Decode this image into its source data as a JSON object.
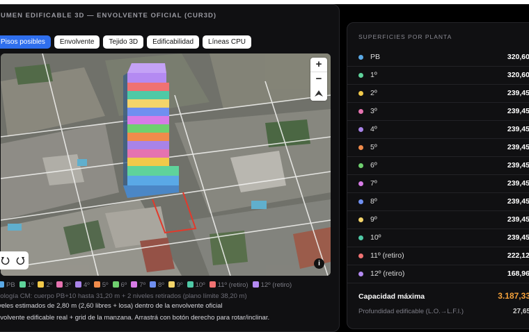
{
  "header": {
    "title": "UMEN EDIFICABLE 3D — ENVOLVENTE OFICIAL (CUR3D)"
  },
  "tabs": [
    {
      "label": "Pisos posibles",
      "active": true
    },
    {
      "label": "Envolvente",
      "active": false
    },
    {
      "label": "Tejido 3D",
      "active": false
    },
    {
      "label": "Edificabilidad",
      "active": false
    },
    {
      "label": "Líneas CPU",
      "active": false
    }
  ],
  "map": {
    "zoom_in": "+",
    "zoom_out": "−",
    "info": "i",
    "rotate_left_icon": "rotate-left-icon",
    "rotate_right_icon": "rotate-right-icon"
  },
  "legend": [
    {
      "label": "PB",
      "color": "#5aa9e6"
    },
    {
      "label": "1º",
      "color": "#5fd39b"
    },
    {
      "label": "2º",
      "color": "#f1c94a"
    },
    {
      "label": "3º",
      "color": "#e573b0"
    },
    {
      "label": "4º",
      "color": "#a883e8"
    },
    {
      "label": "5º",
      "color": "#f08b4b"
    },
    {
      "label": "6º",
      "color": "#6fcf6f"
    },
    {
      "label": "7º",
      "color": "#d77be6"
    },
    {
      "label": "8º",
      "color": "#6f8ff0"
    },
    {
      "label": "9º",
      "color": "#f4d46a"
    },
    {
      "label": "10º",
      "color": "#4fc9a6"
    },
    {
      "label": "11º (retiro)",
      "color": "#f07272"
    },
    {
      "label": "12º (retiro)",
      "color": "#b48af2"
    }
  ],
  "notes": {
    "line1": "pología CM: cuerpo PB+10 hasta 31,20 m + 2 niveles retirados (plano límite 38,20 m)",
    "line2": "iveles estimados de 2,80 m (2,60 libres + losa) dentro de la envolvente oficial",
    "line3": "nvolvente edificable real + grid de la manzana. Arrastrá con botón derecho para rotar/inclinar."
  },
  "surfaces": {
    "title": "SUPERFICIES POR PLANTA",
    "rows": [
      {
        "label": "PB",
        "value": "320,60",
        "color": "#5aa9e6"
      },
      {
        "label": "1º",
        "value": "320,60",
        "color": "#5fd39b"
      },
      {
        "label": "2º",
        "value": "239,45",
        "color": "#f1c94a"
      },
      {
        "label": "3º",
        "value": "239,45",
        "color": "#e573b0"
      },
      {
        "label": "4º",
        "value": "239,45",
        "color": "#a883e8"
      },
      {
        "label": "5º",
        "value": "239,45",
        "color": "#f08b4b"
      },
      {
        "label": "6º",
        "value": "239,45",
        "color": "#6fcf6f"
      },
      {
        "label": "7º",
        "value": "239,45",
        "color": "#d77be6"
      },
      {
        "label": "8º",
        "value": "239,45",
        "color": "#6f8ff0"
      },
      {
        "label": "9º",
        "value": "239,45",
        "color": "#f4d46a"
      },
      {
        "label": "10º",
        "value": "239,45",
        "color": "#4fc9a6"
      },
      {
        "label": "11º (retiro)",
        "value": "222,12",
        "color": "#f07272"
      },
      {
        "label": "12º (retiro)",
        "value": "168,96",
        "color": "#b48af2"
      }
    ],
    "capacity_label": "Capacidad máxima",
    "capacity_value": "3.187,33",
    "depth_label": "Profundidad edificable (L.O.→L.F.I.)",
    "depth_value": "27,65"
  }
}
